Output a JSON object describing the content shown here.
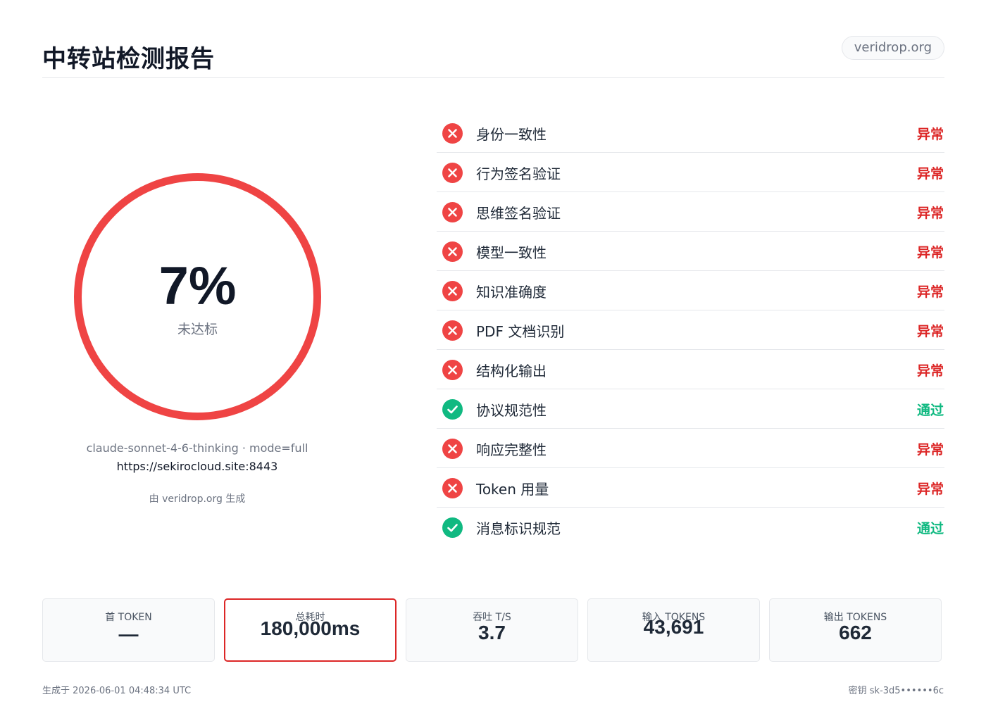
{
  "header": {
    "title": "中转站检测报告",
    "domain": "veridrop.org"
  },
  "score": {
    "value": "7%",
    "percent": 7,
    "label": "未达标",
    "ring_color": "#ef4444"
  },
  "meta": {
    "model_line": "claude-sonnet-4-6-thinking · mode=full",
    "url": "https://sekirocloud.site:8443",
    "generated_by": "由 veridrop.org 生成"
  },
  "checks": [
    {
      "name": "身份一致性",
      "status": "异常",
      "result": "fail",
      "icon": "x-circle-icon"
    },
    {
      "name": "行为签名验证",
      "status": "异常",
      "result": "fail",
      "icon": "x-circle-icon"
    },
    {
      "name": "思维签名验证",
      "status": "异常",
      "result": "fail",
      "icon": "x-circle-icon"
    },
    {
      "name": "模型一致性",
      "status": "异常",
      "result": "fail",
      "icon": "x-circle-icon"
    },
    {
      "name": "知识准确度",
      "status": "异常",
      "result": "fail",
      "icon": "x-circle-icon"
    },
    {
      "name": "PDF 文档识别",
      "status": "异常",
      "result": "fail",
      "icon": "x-circle-icon"
    },
    {
      "name": "结构化输出",
      "status": "异常",
      "result": "fail",
      "icon": "x-circle-icon"
    },
    {
      "name": "协议规范性",
      "status": "通过",
      "result": "pass",
      "icon": "check-circle-icon"
    },
    {
      "name": "响应完整性",
      "status": "异常",
      "result": "fail",
      "icon": "x-circle-icon"
    },
    {
      "name": "Token 用量",
      "status": "异常",
      "result": "fail",
      "icon": "x-circle-icon"
    },
    {
      "name": "消息标识规范",
      "status": "通过",
      "result": "pass",
      "icon": "check-circle-icon"
    }
  ],
  "stats": [
    {
      "label": "首 TOKEN",
      "value": "—"
    },
    {
      "label": "总耗时",
      "value": "180,000ms",
      "highlight": true
    },
    {
      "label": "吞吐 T/S",
      "value": "3.7"
    },
    {
      "label": "输入 TOKENS",
      "value": "43,691"
    },
    {
      "label": "输出 TOKENS",
      "value": "662"
    }
  ],
  "footer": {
    "generated_at": "生成于 2026-06-01 04:48:34 UTC",
    "key": "密钥 sk-3d5••••••6c"
  },
  "colors": {
    "fail": "#dc2626",
    "pass": "#10b981",
    "accent": "#ef4444"
  }
}
